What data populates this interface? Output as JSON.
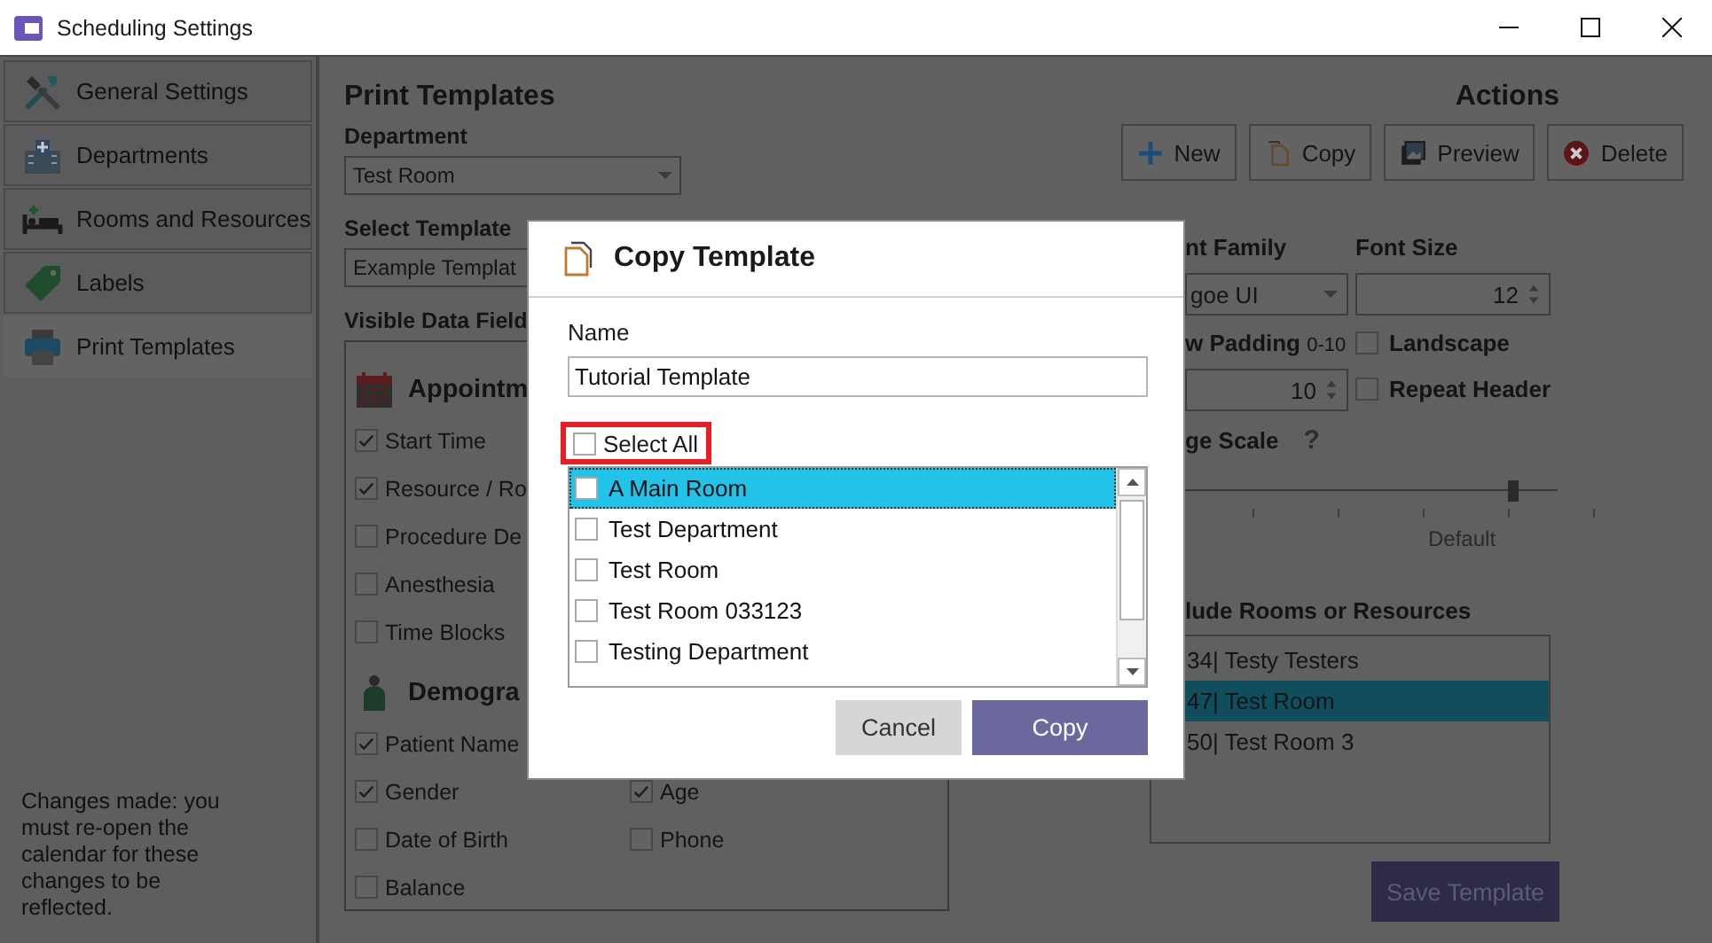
{
  "window": {
    "title": "Scheduling Settings"
  },
  "sidebar": {
    "items": [
      {
        "label": "General Settings",
        "kind": "tools",
        "selected": false
      },
      {
        "label": "Departments",
        "kind": "building",
        "selected": false
      },
      {
        "label": "Rooms and Resources",
        "kind": "bed",
        "selected": false
      },
      {
        "label": "Labels",
        "kind": "tag",
        "selected": false
      },
      {
        "label": "Print Templates",
        "kind": "printer",
        "selected": true
      }
    ],
    "note": "Changes made: you must re-open the calendar for these changes to be reflected."
  },
  "main": {
    "heading": "Print Templates",
    "department": {
      "label": "Department",
      "value": "Test Room"
    },
    "template": {
      "label": "Select Template",
      "value": "Example Templat"
    },
    "visible_fields_label": "Visible Data Field",
    "groups": [
      {
        "title": "Appointm",
        "kind": "calendar",
        "rows": [
          [
            {
              "label": "Start Time",
              "checked": true
            }
          ],
          [
            {
              "label": "Resource / Ro",
              "checked": true
            }
          ],
          [
            {
              "label": "Procedure De",
              "checked": false
            }
          ],
          [
            {
              "label": "Anesthesia",
              "checked": false
            }
          ],
          [
            {
              "label": "Time Blocks",
              "checked": false
            }
          ]
        ]
      },
      {
        "title": "Demogra",
        "kind": "person",
        "rows": [
          [
            {
              "label": "Patient Name",
              "checked": true
            }
          ],
          [
            {
              "label": "Gender",
              "checked": true
            },
            {
              "label": "Age",
              "checked": true
            }
          ],
          [
            {
              "label": "Date of Birth",
              "checked": false
            },
            {
              "label": "Phone",
              "checked": false
            }
          ],
          [
            {
              "label": "Balance",
              "checked": false
            }
          ]
        ]
      }
    ]
  },
  "actions": {
    "title": "Actions",
    "buttons": [
      {
        "label": "New",
        "kind": "plus"
      },
      {
        "label": "Copy",
        "kind": "copy"
      },
      {
        "label": "Preview",
        "kind": "preview"
      },
      {
        "label": "Delete",
        "kind": "delete"
      }
    ]
  },
  "format": {
    "font_family": {
      "label": "nt Family",
      "value": "goe UI"
    },
    "font_size": {
      "label": "Font Size",
      "value": "12"
    },
    "row_padding": {
      "label": "w Padding",
      "range": "0-10",
      "value": "10"
    },
    "landscape": {
      "label": "Landscape",
      "checked": false
    },
    "repeat_header": {
      "label": "Repeat Header",
      "checked": false
    },
    "page_scale": {
      "label": "ge Scale",
      "help": "?",
      "level": 0.88,
      "tick_label": "Default"
    }
  },
  "include": {
    "label": "lude Rooms or Resources",
    "items": [
      {
        "label": "34| Testy Testers",
        "selected": false
      },
      {
        "label": "47| Test Room",
        "selected": true
      },
      {
        "label": "50| Test Room 3",
        "selected": false
      }
    ]
  },
  "save_button": {
    "label": "Save Template",
    "disabled": true
  },
  "dialog": {
    "title": "Copy Template",
    "name": {
      "label": "Name",
      "value": "Tutorial Template"
    },
    "select_all": {
      "label": "Select All",
      "checked": false,
      "highlighted": true
    },
    "items": [
      {
        "label": "A Main Room",
        "checked": false,
        "selected": true
      },
      {
        "label": "Test Department",
        "checked": false,
        "selected": false
      },
      {
        "label": "Test Room",
        "checked": false,
        "selected": false
      },
      {
        "label": "Test Room 033123",
        "checked": false,
        "selected": false
      },
      {
        "label": "Testing Department",
        "checked": false,
        "selected": false
      }
    ],
    "buttons": [
      {
        "label": "Cancel",
        "kind": "secondary"
      },
      {
        "label": "Copy",
        "kind": "primary"
      }
    ]
  }
}
